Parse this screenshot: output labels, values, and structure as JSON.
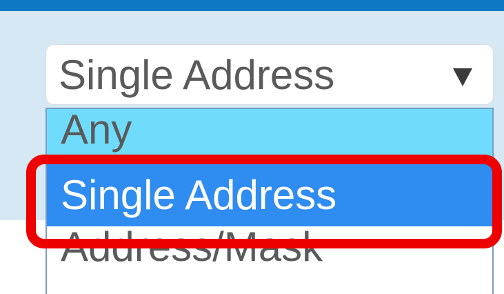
{
  "select": {
    "value": "Single Address",
    "arrow_icon": "triangle-down-icon"
  },
  "dropdown": {
    "options": [
      {
        "label": "Any",
        "state": "hover"
      },
      {
        "label": "Single Address",
        "state": "selected"
      },
      {
        "label": "Address/Mask",
        "state": "normal"
      }
    ]
  },
  "colors": {
    "top_bar": "#0e78c7",
    "panel_background": "#d5e8f3",
    "hover_option": "#6fdcfd",
    "selected_option": "#2f8cf0",
    "highlight": "#ee0000"
  }
}
